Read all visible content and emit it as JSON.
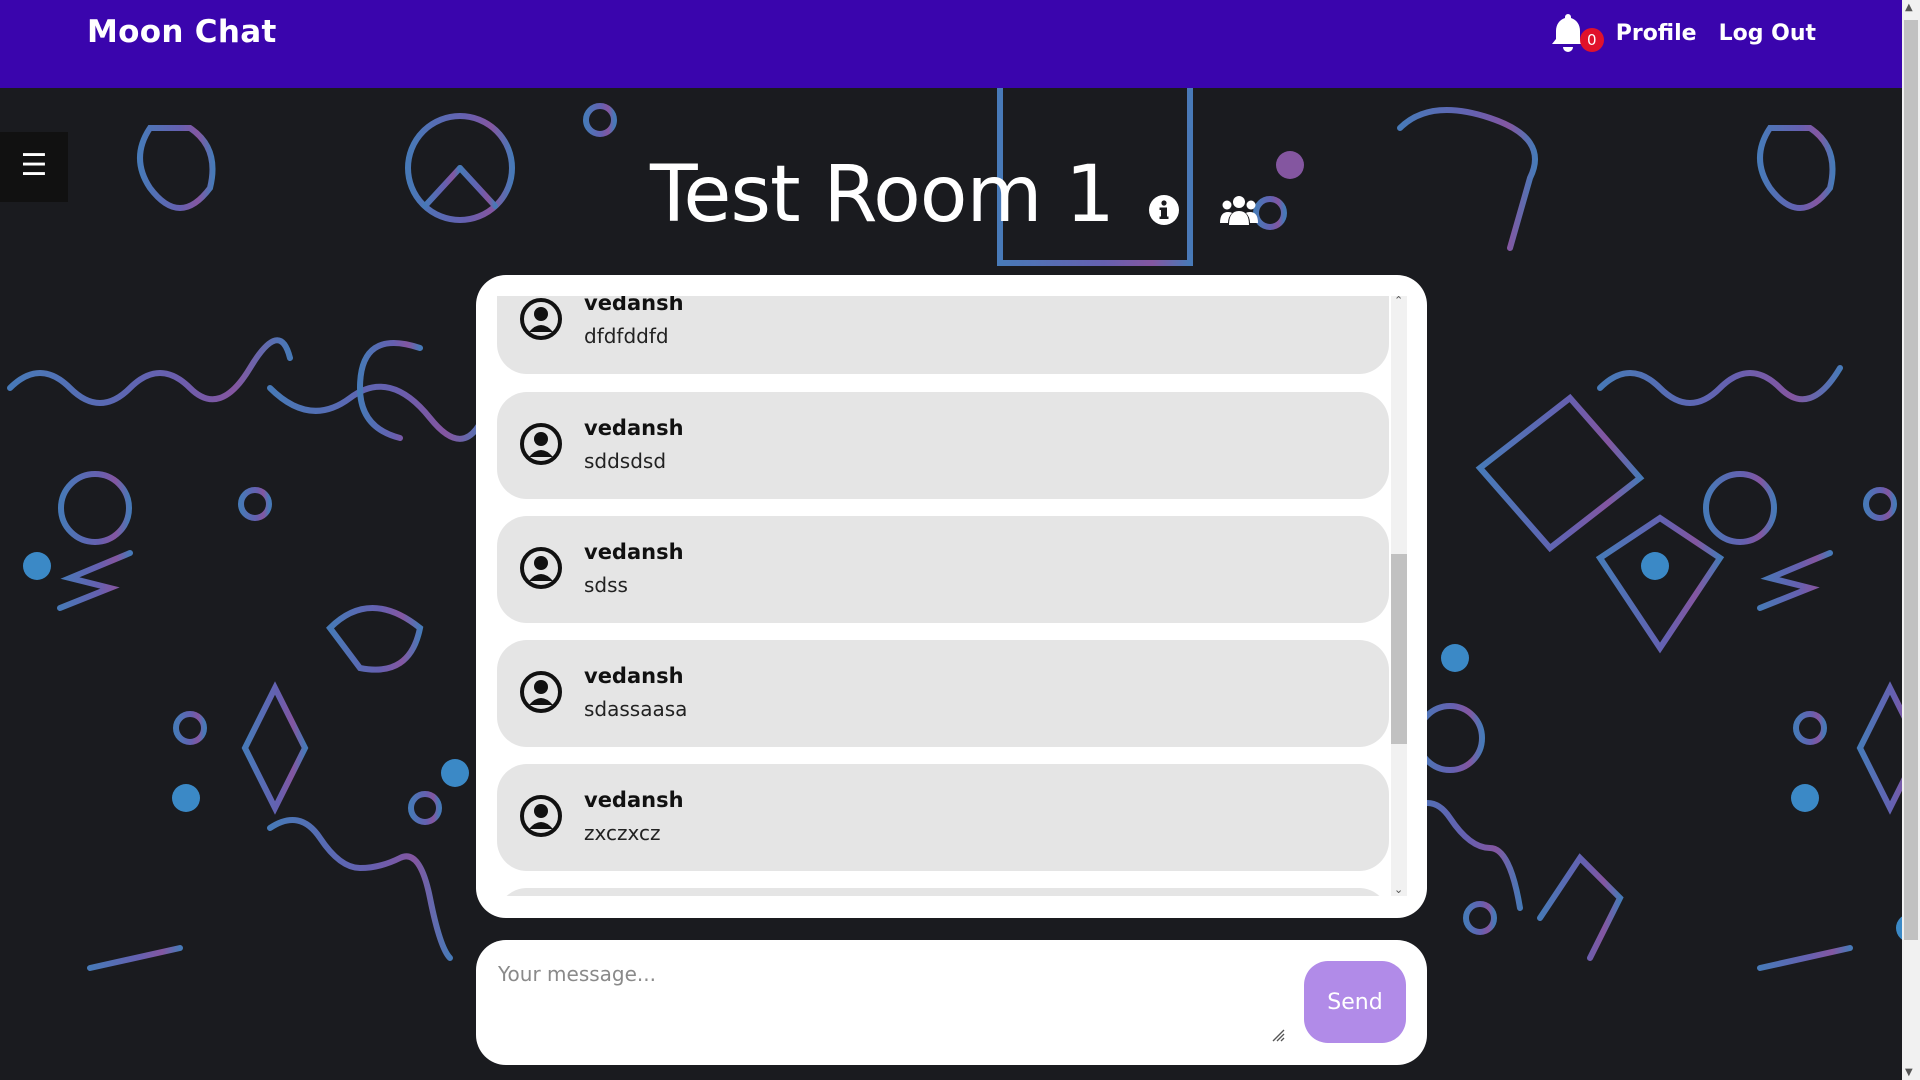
{
  "navbar": {
    "brand": "Moon Chat",
    "notification_count": "0",
    "profile_label": "Profile",
    "logout_label": "Log Out"
  },
  "sidebar_toggle": {
    "icon": "☰"
  },
  "room": {
    "title": "Test Room 1"
  },
  "messages": [
    {
      "user": "vedansh",
      "text": "dfdfddfd"
    },
    {
      "user": "vedansh",
      "text": "sddsdsd"
    },
    {
      "user": "vedansh",
      "text": "sdss"
    },
    {
      "user": "vedansh",
      "text": "sdassaasa"
    },
    {
      "user": "vedansh",
      "text": "zxczxcz"
    }
  ],
  "composer": {
    "placeholder": "Your message...",
    "send_label": "Send"
  },
  "colors": {
    "navbar": "#3a05ad",
    "send_button": "#b18be8",
    "badge": "#e0122b",
    "message_bubble": "#e5e5e5"
  }
}
